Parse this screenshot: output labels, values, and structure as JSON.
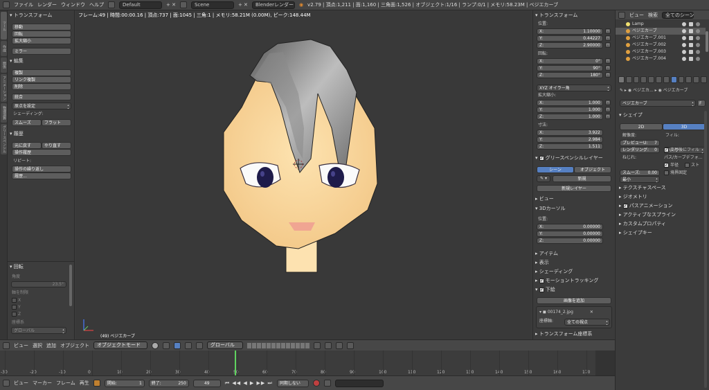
{
  "topbar": {
    "menus": [
      "ファイル",
      "レンダー",
      "ウィンドウ",
      "ヘルプ"
    ],
    "layout": "Default",
    "scene": "Scene",
    "engine": "Blenderレンダー",
    "stats": "v2.79 | 頂点:1,211 | 面:1,160 | 三角面:1,526 | オブジェクト:1/16 | ランプ:0/1 | メモリ:58.23M | ベジエカーブ"
  },
  "lefttabs": [
    "ツール",
    "作成",
    "関係",
    "アニメーション",
    "物理演算",
    "グリースペンシル"
  ],
  "toolshelf": {
    "transform_header": "トランスフォーム",
    "transform_buttons": [
      "移動",
      "回転",
      "拡大縮小"
    ],
    "mirror": "ミラー",
    "edit_header": "編集",
    "edit_buttons": [
      "複製",
      "リンク複製",
      "削除"
    ],
    "join": "統合",
    "origin": "原点を設定",
    "shading_label": "シェーディング:",
    "smooth": "スムーズ",
    "flat": "フラット",
    "history_header": "履歴",
    "undo": "元に戻す",
    "redo": "やり直す",
    "undo_history": "操作履歴",
    "repeat_label": "リピート:",
    "repeat_last": "操作の繰り返し",
    "repeat_history": "履歴...",
    "rotate_header": "回転",
    "angle_label": "角度",
    "angle_value": "23.5°",
    "axis_label": "軸を制限",
    "axes": [
      "X",
      "Y",
      "Z"
    ],
    "orient_label": "座標系",
    "orient_value": "グローバル"
  },
  "viewport": {
    "info": "フレーム:49 | 時間:00:00.16 | 頂点:737 | 面:1045 | 三角:1 | メモリ:58.21M (0.00M), ピーク:148.44M",
    "object_label": "(49) ベジエカーブ"
  },
  "props": {
    "transform_header": "トランスフォーム",
    "location_label": "位置:",
    "location": [
      {
        "axis": "X:",
        "value": "1.10000"
      },
      {
        "axis": "Y:",
        "value": "0.44227"
      },
      {
        "axis": "Z:",
        "value": "2.90000"
      }
    ],
    "rotation_label": "回転:",
    "rotation": [
      {
        "axis": "X:",
        "value": "0°"
      },
      {
        "axis": "Y:",
        "value": "90°"
      },
      {
        "axis": "Z:",
        "value": "180°"
      }
    ],
    "rot_mode": "XYZ オイラー角",
    "scale_label": "拡大縮小:",
    "scale": [
      {
        "axis": "X:",
        "value": "1.000"
      },
      {
        "axis": "Y:",
        "value": "1.000"
      },
      {
        "axis": "Z:",
        "value": "1.000"
      }
    ],
    "dim_label": "寸法:",
    "dims": [
      {
        "axis": "X:",
        "value": "3.922"
      },
      {
        "axis": "Y:",
        "value": "2.984"
      },
      {
        "axis": "Z:",
        "value": "1.511"
      }
    ],
    "gp_header": "グリースペンシルレイヤー",
    "gp_scene": "シーン",
    "gp_object": "オブジェクト",
    "gp_new": "新規",
    "gp_new_layer": "新規レイヤー",
    "view_header": "ビュー",
    "cursor_header": "3Dカーソル",
    "cursor_label": "位置:",
    "cursor": [
      {
        "axis": "X:",
        "value": "0.00000"
      },
      {
        "axis": "Y:",
        "value": "0.00000"
      },
      {
        "axis": "Z:",
        "value": "0.00000"
      }
    ],
    "item_header": "アイテム",
    "display_header": "表示",
    "shading_header": "シェーディング",
    "motion_header": "モーショントラッキング",
    "bg_header": "下絵",
    "add_image": "画像を追加",
    "image_name": "00174_2.jpg",
    "axis_label": "座標軸:",
    "axis_value": "全ての視点",
    "transform_orient_header": "トランスフォーム座標系"
  },
  "outliner": {
    "view": "ビュー",
    "search": "検索",
    "filter": "全てのシーン",
    "items": [
      "Lamp",
      "ベジエカーブ",
      "ベジエカーブ.001",
      "ベジエカーブ.002",
      "ベジエカーブ.003",
      "ベジエカーブ.004"
    ]
  },
  "objprops": {
    "breadcrumb1": "ベジエカ...",
    "breadcrumb2": "ベジエカーブ",
    "datablock": "ベジエカーブ",
    "fake": "F",
    "shape_header": "シェイプ",
    "tab2d": "2D",
    "tab3d": "3D",
    "resolution_label": "解像度:",
    "fill_label": "フィル:",
    "preview_label": "プレビューU:",
    "preview_value": "7",
    "render_label": "レンダリング:",
    "render_value": "0",
    "fill_value": "ハーフ",
    "fill_deform": "変形後にフィル",
    "twist_label": "ねじれ:",
    "twist_value": "最小",
    "smooth_label": "スムーズ:",
    "smooth_value": "0.00",
    "path_label": "パス/カーブデフォ...",
    "radius": "半径",
    "stretch": "スト",
    "bounds": "境界固定",
    "sections": [
      "テクスチャスペース",
      "ジオメトリ",
      "パスアニメーション",
      "アクティブなスプライン",
      "カスタムプロパティ",
      "シェイプキー"
    ]
  },
  "vp_header": {
    "view": "ビュー",
    "select": "選択",
    "add": "追加",
    "object": "オブジェクト",
    "mode": "オブジェクトモード",
    "orientation": "グローバル"
  },
  "timeline": {
    "ticks": [
      "-30",
      "-20",
      "-10",
      "0",
      "10",
      "20",
      "30",
      "40",
      "50",
      "60",
      "70",
      "80",
      "90",
      "100",
      "110",
      "120",
      "130",
      "140",
      "150",
      "160",
      "170",
      "180",
      "190",
      "200",
      "210",
      "220",
      "230",
      "240",
      "250",
      "260"
    ],
    "current_frame": 49
  },
  "tl_footer": {
    "view": "ビュー",
    "marker": "マーカー",
    "frame": "フレーム",
    "playback": "再生",
    "start_label": "開始:",
    "start": "1",
    "end_label": "終了:",
    "end": "250",
    "current": "49",
    "sync": "同期しない"
  }
}
